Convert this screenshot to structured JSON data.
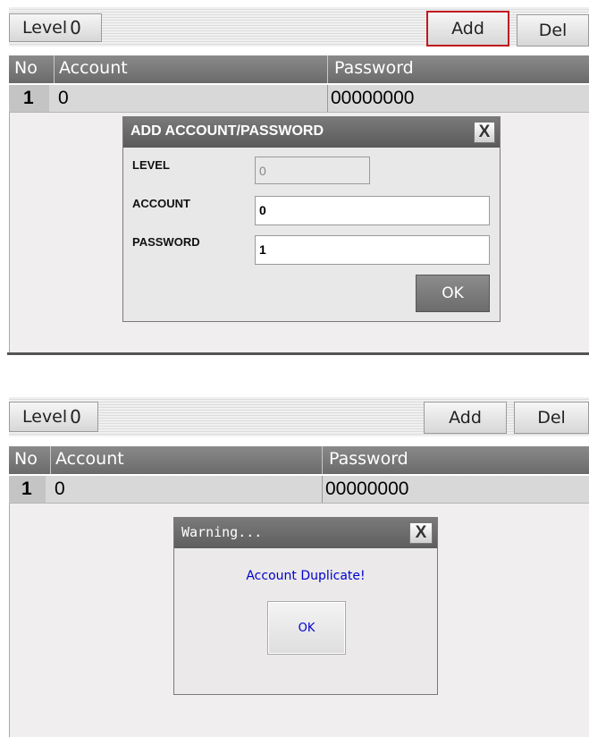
{
  "top": {
    "toolbar": {
      "level_label": "Level",
      "level_value": "0",
      "add_label": "Add",
      "del_label": "Del"
    },
    "table": {
      "columns": [
        "No",
        "Account",
        "Password"
      ],
      "rows": [
        {
          "no": "1",
          "account": "0",
          "password": "00000000"
        }
      ]
    },
    "dialog": {
      "title": "ADD ACCOUNT/PASSWORD",
      "close_label": "X",
      "level_label": "LEVEL",
      "level_value": "0",
      "account_label": "ACCOUNT",
      "account_value": "0",
      "password_label": "PASSWORD",
      "password_value": "1",
      "ok_label": "OK"
    },
    "highlight_color": "#c0181f"
  },
  "bottom": {
    "toolbar": {
      "level_label": "Level",
      "level_value": "0",
      "add_label": "Add",
      "del_label": "Del"
    },
    "table": {
      "columns": [
        "No",
        "Account",
        "Password"
      ],
      "rows": [
        {
          "no": "1",
          "account": "0",
          "password": "00000000"
        }
      ]
    },
    "warning": {
      "title": "Warning...",
      "close_label": "X",
      "message": "Account Duplicate!",
      "ok_label": "OK",
      "message_color": "#0000cc"
    }
  }
}
